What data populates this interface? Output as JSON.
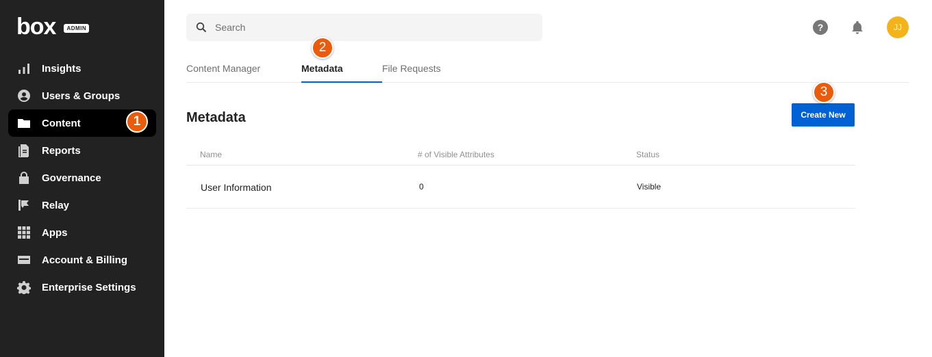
{
  "brand": {
    "logo": "box",
    "badge": "ADMIN"
  },
  "sidebar": {
    "items": [
      {
        "label": "Insights",
        "icon": "bar-chart-icon"
      },
      {
        "label": "Users & Groups",
        "icon": "user-circle-icon"
      },
      {
        "label": "Content",
        "icon": "folder-icon",
        "active": true
      },
      {
        "label": "Reports",
        "icon": "reports-icon"
      },
      {
        "label": "Governance",
        "icon": "lock-icon"
      },
      {
        "label": "Relay",
        "icon": "relay-icon"
      },
      {
        "label": "Apps",
        "icon": "grid-icon"
      },
      {
        "label": "Account & Billing",
        "icon": "credit-card-icon"
      },
      {
        "label": "Enterprise Settings",
        "icon": "gear-icon"
      }
    ]
  },
  "search": {
    "placeholder": "Search"
  },
  "header": {
    "avatar_initials": "JJ",
    "avatar_color": "#f5b31b"
  },
  "tabs": [
    {
      "label": "Content Manager"
    },
    {
      "label": "Metadata",
      "active": true
    },
    {
      "label": "File Requests"
    }
  ],
  "main": {
    "title": "Metadata",
    "create_button": "Create New",
    "table": {
      "columns": [
        "Name",
        "# of Visible Attributes",
        "Status"
      ],
      "rows": [
        {
          "name": "User Information",
          "attributes": "0",
          "status": "Visible"
        }
      ]
    }
  },
  "steps": [
    "1",
    "2",
    "3"
  ],
  "colors": {
    "accent": "#0061d5",
    "sidebar": "#222222",
    "step": "#ea5b0c"
  }
}
